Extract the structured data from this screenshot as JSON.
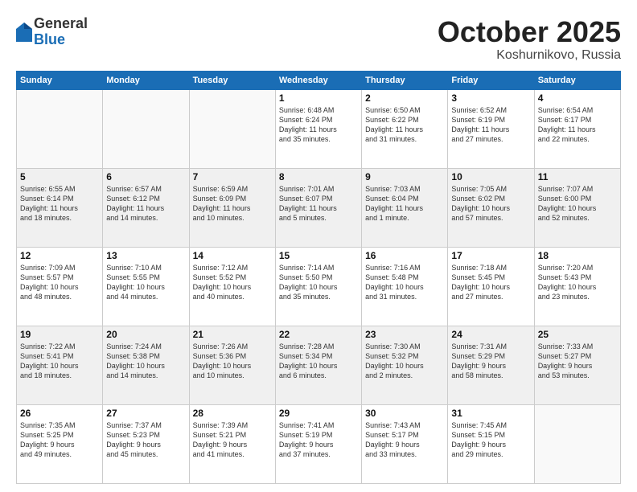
{
  "logo": {
    "general": "General",
    "blue": "Blue"
  },
  "title": "October 2025",
  "location": "Koshurnikovo, Russia",
  "days_header": [
    "Sunday",
    "Monday",
    "Tuesday",
    "Wednesday",
    "Thursday",
    "Friday",
    "Saturday"
  ],
  "weeks": [
    {
      "shade": false,
      "days": [
        {
          "num": "",
          "info": ""
        },
        {
          "num": "",
          "info": ""
        },
        {
          "num": "",
          "info": ""
        },
        {
          "num": "1",
          "info": "Sunrise: 6:48 AM\nSunset: 6:24 PM\nDaylight: 11 hours\nand 35 minutes."
        },
        {
          "num": "2",
          "info": "Sunrise: 6:50 AM\nSunset: 6:22 PM\nDaylight: 11 hours\nand 31 minutes."
        },
        {
          "num": "3",
          "info": "Sunrise: 6:52 AM\nSunset: 6:19 PM\nDaylight: 11 hours\nand 27 minutes."
        },
        {
          "num": "4",
          "info": "Sunrise: 6:54 AM\nSunset: 6:17 PM\nDaylight: 11 hours\nand 22 minutes."
        }
      ]
    },
    {
      "shade": true,
      "days": [
        {
          "num": "5",
          "info": "Sunrise: 6:55 AM\nSunset: 6:14 PM\nDaylight: 11 hours\nand 18 minutes."
        },
        {
          "num": "6",
          "info": "Sunrise: 6:57 AM\nSunset: 6:12 PM\nDaylight: 11 hours\nand 14 minutes."
        },
        {
          "num": "7",
          "info": "Sunrise: 6:59 AM\nSunset: 6:09 PM\nDaylight: 11 hours\nand 10 minutes."
        },
        {
          "num": "8",
          "info": "Sunrise: 7:01 AM\nSunset: 6:07 PM\nDaylight: 11 hours\nand 5 minutes."
        },
        {
          "num": "9",
          "info": "Sunrise: 7:03 AM\nSunset: 6:04 PM\nDaylight: 11 hours\nand 1 minute."
        },
        {
          "num": "10",
          "info": "Sunrise: 7:05 AM\nSunset: 6:02 PM\nDaylight: 10 hours\nand 57 minutes."
        },
        {
          "num": "11",
          "info": "Sunrise: 7:07 AM\nSunset: 6:00 PM\nDaylight: 10 hours\nand 52 minutes."
        }
      ]
    },
    {
      "shade": false,
      "days": [
        {
          "num": "12",
          "info": "Sunrise: 7:09 AM\nSunset: 5:57 PM\nDaylight: 10 hours\nand 48 minutes."
        },
        {
          "num": "13",
          "info": "Sunrise: 7:10 AM\nSunset: 5:55 PM\nDaylight: 10 hours\nand 44 minutes."
        },
        {
          "num": "14",
          "info": "Sunrise: 7:12 AM\nSunset: 5:52 PM\nDaylight: 10 hours\nand 40 minutes."
        },
        {
          "num": "15",
          "info": "Sunrise: 7:14 AM\nSunset: 5:50 PM\nDaylight: 10 hours\nand 35 minutes."
        },
        {
          "num": "16",
          "info": "Sunrise: 7:16 AM\nSunset: 5:48 PM\nDaylight: 10 hours\nand 31 minutes."
        },
        {
          "num": "17",
          "info": "Sunrise: 7:18 AM\nSunset: 5:45 PM\nDaylight: 10 hours\nand 27 minutes."
        },
        {
          "num": "18",
          "info": "Sunrise: 7:20 AM\nSunset: 5:43 PM\nDaylight: 10 hours\nand 23 minutes."
        }
      ]
    },
    {
      "shade": true,
      "days": [
        {
          "num": "19",
          "info": "Sunrise: 7:22 AM\nSunset: 5:41 PM\nDaylight: 10 hours\nand 18 minutes."
        },
        {
          "num": "20",
          "info": "Sunrise: 7:24 AM\nSunset: 5:38 PM\nDaylight: 10 hours\nand 14 minutes."
        },
        {
          "num": "21",
          "info": "Sunrise: 7:26 AM\nSunset: 5:36 PM\nDaylight: 10 hours\nand 10 minutes."
        },
        {
          "num": "22",
          "info": "Sunrise: 7:28 AM\nSunset: 5:34 PM\nDaylight: 10 hours\nand 6 minutes."
        },
        {
          "num": "23",
          "info": "Sunrise: 7:30 AM\nSunset: 5:32 PM\nDaylight: 10 hours\nand 2 minutes."
        },
        {
          "num": "24",
          "info": "Sunrise: 7:31 AM\nSunset: 5:29 PM\nDaylight: 9 hours\nand 58 minutes."
        },
        {
          "num": "25",
          "info": "Sunrise: 7:33 AM\nSunset: 5:27 PM\nDaylight: 9 hours\nand 53 minutes."
        }
      ]
    },
    {
      "shade": false,
      "days": [
        {
          "num": "26",
          "info": "Sunrise: 7:35 AM\nSunset: 5:25 PM\nDaylight: 9 hours\nand 49 minutes."
        },
        {
          "num": "27",
          "info": "Sunrise: 7:37 AM\nSunset: 5:23 PM\nDaylight: 9 hours\nand 45 minutes."
        },
        {
          "num": "28",
          "info": "Sunrise: 7:39 AM\nSunset: 5:21 PM\nDaylight: 9 hours\nand 41 minutes."
        },
        {
          "num": "29",
          "info": "Sunrise: 7:41 AM\nSunset: 5:19 PM\nDaylight: 9 hours\nand 37 minutes."
        },
        {
          "num": "30",
          "info": "Sunrise: 7:43 AM\nSunset: 5:17 PM\nDaylight: 9 hours\nand 33 minutes."
        },
        {
          "num": "31",
          "info": "Sunrise: 7:45 AM\nSunset: 5:15 PM\nDaylight: 9 hours\nand 29 minutes."
        },
        {
          "num": "",
          "info": ""
        }
      ]
    }
  ]
}
